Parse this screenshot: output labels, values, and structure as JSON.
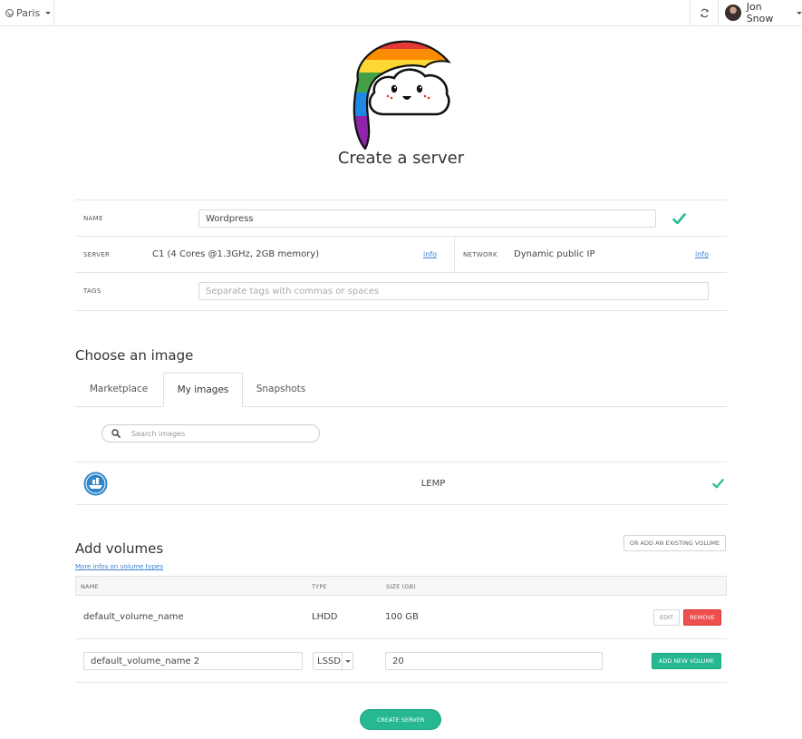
{
  "topbar": {
    "region": "Paris",
    "user_name": "Jon Snow"
  },
  "page_title": "Create a server",
  "form": {
    "name_label": "NAME",
    "name_value": "Wordpress",
    "server_label": "SERVER",
    "server_value": "C1 (4 Cores @1.3GHz, 2GB memory)",
    "server_info": "info",
    "network_label": "NETWORK",
    "network_value": "Dynamic public IP",
    "network_info": "info",
    "tags_label": "TAGS",
    "tags_placeholder": "Separate tags with commas or spaces"
  },
  "images": {
    "title": "Choose an image",
    "tabs": [
      {
        "label": "Marketplace",
        "active": false
      },
      {
        "label": "My images",
        "active": true
      },
      {
        "label": "Snapshots",
        "active": false
      }
    ],
    "search_placeholder": "Search images",
    "items": [
      {
        "name": "LEMP",
        "selected": true
      }
    ]
  },
  "volumes": {
    "title": "Add volumes",
    "existing_button": "OR ADD AN EXISTING VOLUME",
    "info_link": "More infos on volume types",
    "columns": [
      "NAME",
      "TYPE",
      "SIZE (GB)"
    ],
    "rows": [
      {
        "name": "default_volume_name",
        "type": "LHDD",
        "size": "100 GB",
        "edit_label": "EDIT",
        "remove_label": "REMOVE"
      }
    ],
    "new_row": {
      "name_value": "default_volume_name 2",
      "type_value": "LSSD",
      "size_value": "20",
      "add_label": "ADD NEW VOLUME"
    }
  },
  "create_button": "CREATE SERVER",
  "colors": {
    "accent": "#26b890",
    "danger": "#ef4f4f",
    "link": "#3c7fd6"
  }
}
